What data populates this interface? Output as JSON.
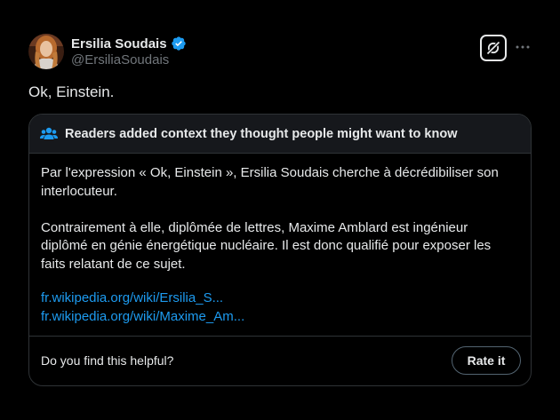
{
  "author": {
    "display_name": "Ersilia Soudais",
    "handle": "@ErsiliaSoudais",
    "verified": true,
    "verified_color": "#1d9bf0"
  },
  "header_actions": {
    "grok_icon": "grok-icon",
    "more_icon": "more-dots-icon"
  },
  "tweet": {
    "text": "Ok, Einstein."
  },
  "community_note": {
    "title": "Readers added context they thought people might want to know",
    "icon": "people-icon",
    "paragraphs": [
      "Par l'expression « Ok, Einstein », Ersilia Soudais cherche à décrédibiliser son interlocuteur.",
      "Contrairement à elle, diplômée de lettres, Maxime Amblard est ingénieur diplômé en génie énergétique nucléaire. Il est donc qualifié pour exposer les faits relatant de ce sujet."
    ],
    "links": [
      "fr.wikipedia.org/wiki/Ersilia_S...",
      "fr.wikipedia.org/wiki/Maxime_Am..."
    ],
    "link_color": "#1d9bf0",
    "helpful_question": "Do you find this helpful?",
    "rate_button": "Rate it"
  }
}
